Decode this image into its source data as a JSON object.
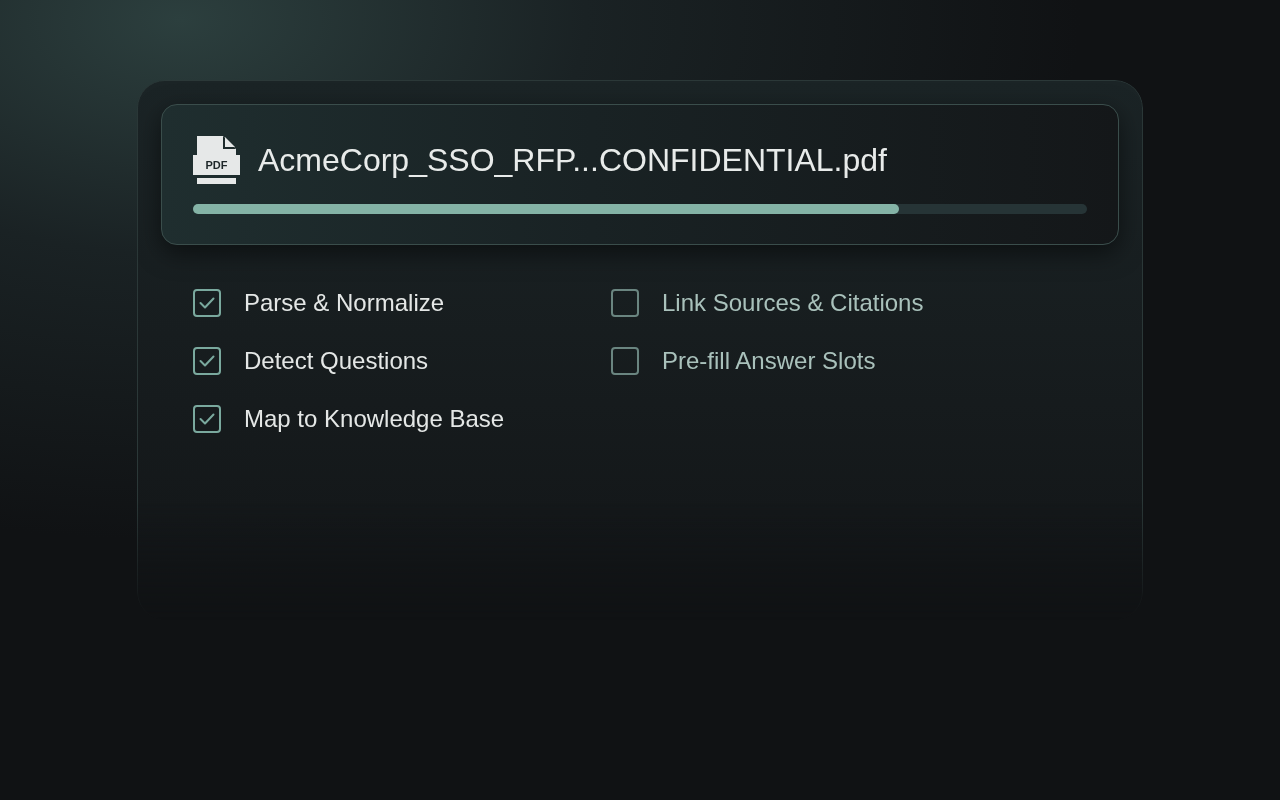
{
  "file": {
    "icon_label": "PDF",
    "name": "AcmeCorp_SSO_RFP...CONFIDENTIAL.pdf",
    "progress": {
      "level": 0.79
    }
  },
  "steps": [
    {
      "label": "Parse & Normalize",
      "checked": true
    },
    {
      "label": "Detect Questions",
      "checked": true
    },
    {
      "label": "Map to Knowledge Base",
      "checked": true
    },
    {
      "label": "Link Sources & Citations",
      "checked": false
    },
    {
      "label": "Pre-fill Answer Slots",
      "checked": false
    }
  ]
}
